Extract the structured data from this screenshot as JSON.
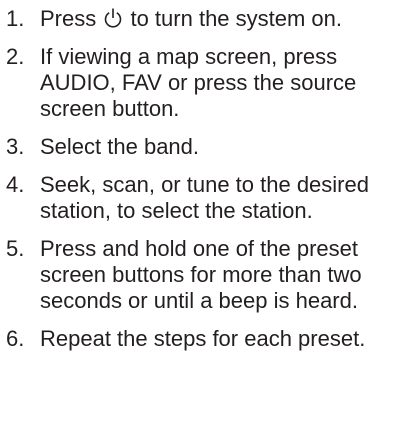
{
  "steps": [
    {
      "number": "1.",
      "text_before_icon": "Press ",
      "icon": "power-icon",
      "text_after_icon": " to turn the system on."
    },
    {
      "number": "2.",
      "text": "If viewing a map screen, press AUDIO, FAV or press the source screen button."
    },
    {
      "number": "3.",
      "text": "Select the band."
    },
    {
      "number": "4.",
      "text": "Seek, scan, or tune to the desired station, to select the station."
    },
    {
      "number": "5.",
      "text": "Press and hold one of the preset screen buttons for more than two seconds or until a beep is heard."
    },
    {
      "number": "6.",
      "text": "Repeat the steps for each preset."
    }
  ]
}
